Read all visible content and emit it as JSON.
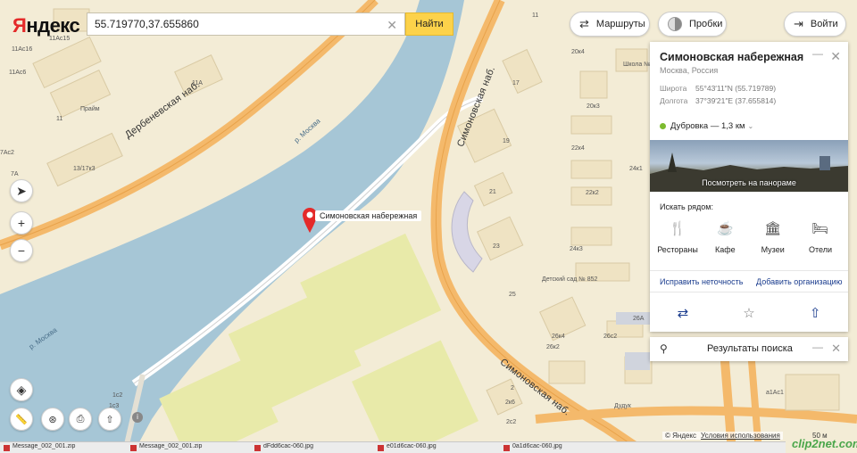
{
  "app": {
    "logo": "Яндекс",
    "logo_first_letter": "Я",
    "logo_rest": "ндекс"
  },
  "search": {
    "value": "55.719770,37.655860",
    "placeholder": "",
    "button_label": "Найти"
  },
  "toolbar": {
    "routes_label": "Маршруты",
    "traffic_label": "Пробки",
    "login_label": "Войти"
  },
  "colors": {
    "accent_yellow": "#fcd24a",
    "water": "#a6c6d6",
    "land": "#f3ecd6",
    "road": "#f4b96b",
    "marker": "#e42a2a",
    "metro_green": "#7dbb2f",
    "link_blue": "#1a3c8e"
  },
  "map": {
    "marker_label": "Симоновская набережная",
    "street_labels": [
      "Дербеневская наб.",
      "Симоновская наб.",
      "Симоновская наб."
    ],
    "river_labels": [
      "р. Москва",
      "р. Москва"
    ],
    "place_labels": [
      "Прайм",
      "Детский сад № 852",
      "Дудук",
      "Школа №"
    ],
    "house_numbers": [
      "11Ас16",
      "11Ас15",
      "11Ас6",
      "11А",
      "11",
      "7Ас2",
      "7А",
      "13/17к3",
      "11",
      "20к4",
      "17",
      "20к3",
      "19",
      "22к4",
      "21",
      "22к2",
      "23",
      "24к3",
      "25",
      "24к1",
      "26А",
      "26к2",
      "26к4",
      "26с2",
      "2",
      "2к6",
      "2с2",
      "1с2",
      "1с3",
      "а1Ас1"
    ]
  },
  "panel": {
    "title": "Симоновская набережная",
    "region": "Москва, Россия",
    "latitude_label": "Широта",
    "latitude_value": "55°43′11″N (55.719789)",
    "longitude_label": "Долгота",
    "longitude_value": "37°39′21″E (37.655814)",
    "metro": "Дубровка — 1,3 км",
    "panorama_caption": "Посмотреть на панораме",
    "nearby_title": "Искать рядом:",
    "categories": [
      {
        "label": "Рестораны",
        "icon": "restaurant-icon"
      },
      {
        "label": "Кафе",
        "icon": "cafe-icon"
      },
      {
        "label": "Музеи",
        "icon": "museum-icon"
      },
      {
        "label": "Отели",
        "icon": "hotel-icon"
      }
    ],
    "fix_link": "Исправить неточность",
    "add_org_link": "Добавить организацию"
  },
  "results": {
    "label": "Результаты поиска"
  },
  "footer": {
    "copyright": "© Яндекс",
    "terms": "Условия использования",
    "scale": "50 м",
    "watermark": "clip2net.com"
  },
  "taskbar": {
    "items": [
      "Message_002_001.zip",
      "Message_002_001.zip",
      "dFdd6cac-060.jpg",
      "e01d6cac-060.jpg",
      "0a1d6cac-060.jpg"
    ]
  }
}
